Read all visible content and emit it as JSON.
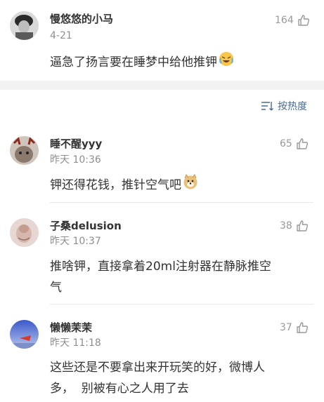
{
  "top_comment": {
    "username": "慢悠悠的小马",
    "time": "4-21",
    "likes": "164",
    "text": "逼急了扬言要在睡梦中给他推钾",
    "emoji": "crying-laughing-emoji"
  },
  "sort": {
    "label": "按热度",
    "icon": "sort-lines-icon"
  },
  "comments": [
    {
      "username": "睡不醒yyy",
      "time": "昨天 10:36",
      "likes": "65",
      "text": "钾还得花钱，推针空气吧",
      "emoji": "doge-emoji"
    },
    {
      "username": "子桑delusion",
      "time": "昨天 10:37",
      "likes": "38",
      "text_line1": "推啥钾，直接拿着20ml注射器在静脉推空",
      "text_line2": "气"
    },
    {
      "username": "懒懒茉茉",
      "time": "昨天 11:18",
      "likes": "37",
      "text_line1": "这些还是不要拿出来开玩笑的好，微博人",
      "text_line2": "多，  别被有心之人用了去"
    }
  ],
  "colors": {
    "link_blue": "#4a6b94",
    "band_gray": "#f2f2f2",
    "meta_gray": "#8f8f8f"
  }
}
